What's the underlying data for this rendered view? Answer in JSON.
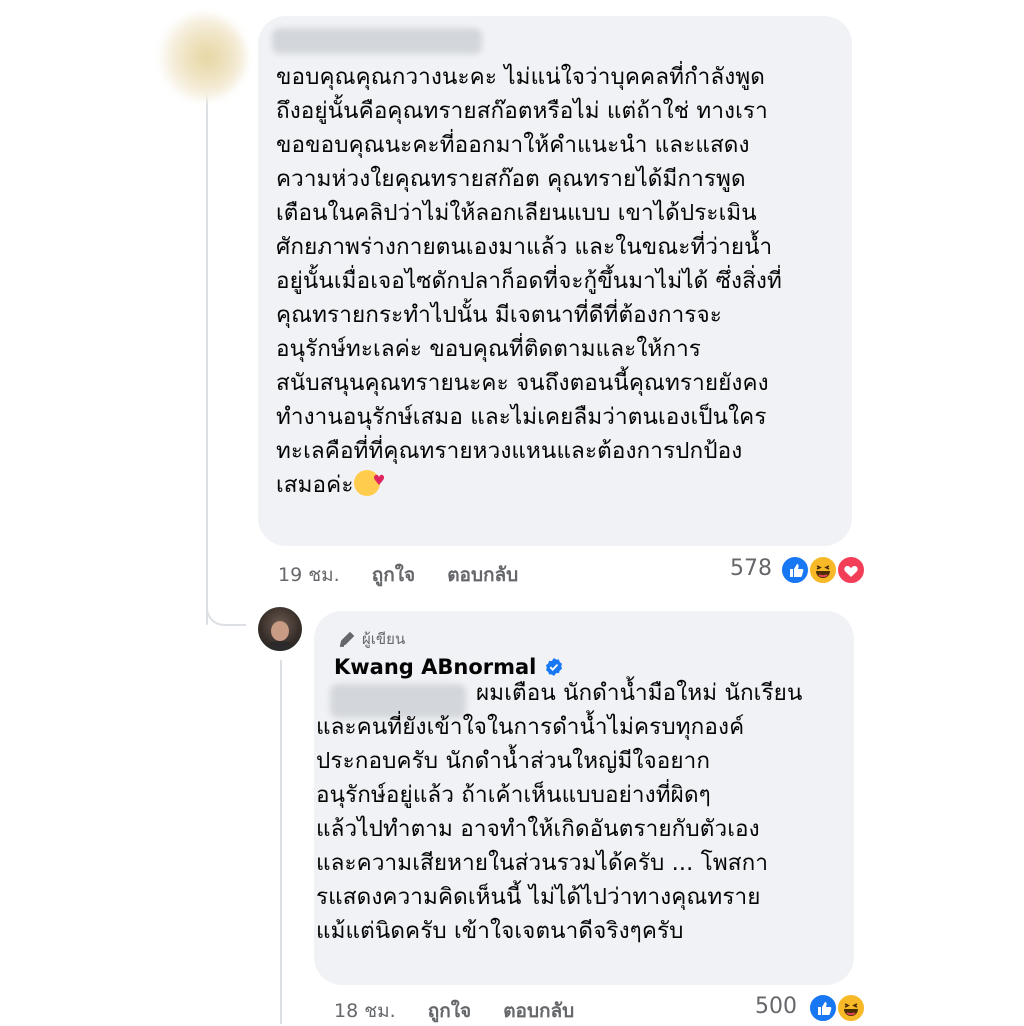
{
  "comment": {
    "text": "ขอบคุณคุณกวางนะคะ ไม่แน่ใจว่าบุคคลที่กำลังพูด\nถึงอยู่นั้นคือคุณทรายสก๊อตหรือไม่ แต่ถ้าใช่ ทางเรา\nขอขอบคุณนะคะที่ออกมาให้คำแนะนำ และแสดง\nความห่วงใยคุณทรายสก๊อต คุณทรายได้มีการพูด\nเตือนในคลิปว่าไม่ให้ลอกเลียนแบบ เขาได้ประเมิน\nศักยภาพร่างกายตนเองมาแล้ว และในขณะที่ว่ายน้ำ\nอยู่นั้นเมื่อเจอไซดักปลาก็อดที่จะกู้ขึ้นมาไม่ได้ ซึ่งสิ่งที่\nคุณทรายกระทำไปนั้น มีเจตนาที่ดีที่ต้องการจะ\nอนุรักษ์ทะเลค่ะ ขอบคุณที่ติดตามและให้การ\nสนับสนุนคุณทรายนะคะ จนถึงตอนนี้คุณทรายยังคง\nทำงานอนุรักษ์เสมอ และไม่เคยลืมว่าตนเองเป็นใคร\nทะเลคือที่ที่คุณทรายหวงแหนและต้องการปกป้อง\nเสมอค่ะ",
    "emoji": "smiling-face-with-hearts",
    "time": "19 ชม.",
    "like_label": "ถูกใจ",
    "reply_label": "ตอบกลับ",
    "reaction_count": "578",
    "reactions": [
      "like",
      "haha",
      "love"
    ]
  },
  "reply": {
    "badge": "ผู้เขียน",
    "author": "Kwang ABnormal",
    "text": "ผมเตือน นักดำน้ำมือใหม่ นักเรียน\nและคนที่ยังเข้าใจในการดำน้ำไม่ครบทุกองค์\nประกอบครับ นักดำน้ำส่วนใหญ่มีใจอยาก\nอนุรักษ์อยู่แล้ว ถ้าเค้าเห็นแบบอย่างที่ผิดๆ\nแล้วไปทำตาม อาจทำให้เกิดอันตรายกับตัวเอง\nและความเสียหายในส่วนรวมได้ครับ ... โพสกา\nรแสดงความคิดเห็นนี้ ไม่ได้ไปว่าทางคุณทราย\nแม้แต่นิดครับ เข้าใจเจตนาดีจริงๆครับ",
    "time": "18 ชม.",
    "like_label": "ถูกใจ",
    "reply_label": "ตอบกลับ",
    "reaction_count": "500",
    "reactions": [
      "like",
      "haha"
    ]
  },
  "colors": {
    "bubble": "#f0f2f5",
    "meta_text": "#65676b",
    "like": "#1877f2",
    "haha": "#f7b928",
    "love": "#f33e58",
    "verified": "#1877f2"
  }
}
